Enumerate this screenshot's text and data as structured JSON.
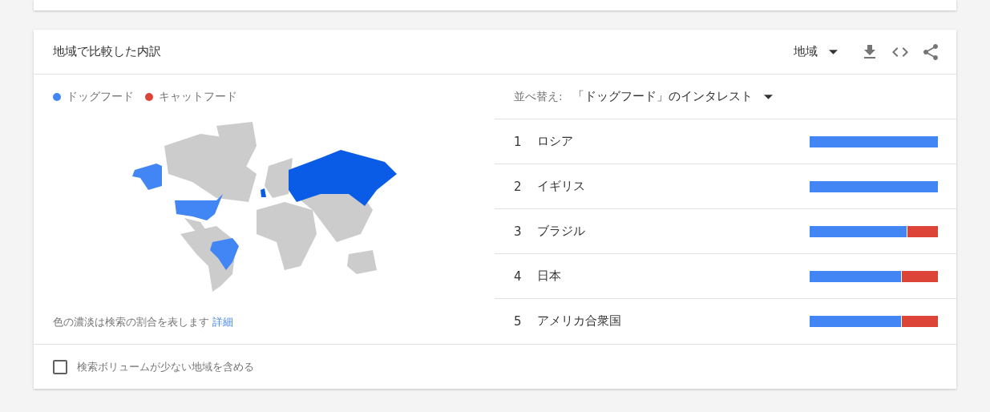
{
  "card": {
    "title": "地域で比較した内訳",
    "region_select": {
      "label": "地域"
    }
  },
  "legend": [
    {
      "label": "ドッグフード",
      "color": "#4285f4"
    },
    {
      "label": "キャットフード",
      "color": "#db4437"
    }
  ],
  "map_note": {
    "text": "色の濃淡は検索の割合を表します",
    "link": "詳細"
  },
  "sort": {
    "label": "並べ替え:",
    "value": "「ドッグフード」のインタレスト"
  },
  "ranking": [
    {
      "rank": "1",
      "name": "ロシア",
      "level": 1.0
    },
    {
      "rank": "2",
      "name": "イギリス",
      "level": 1.0
    },
    {
      "rank": "3",
      "name": "ブラジル",
      "level": 0.76
    },
    {
      "rank": "4",
      "name": "日本",
      "level": 0.72
    },
    {
      "rank": "5",
      "name": "アメリカ合衆国",
      "level": 0.72
    }
  ],
  "low_volume": {
    "label": "検索ボリュームが少ない地域を含める",
    "checked": false
  }
}
